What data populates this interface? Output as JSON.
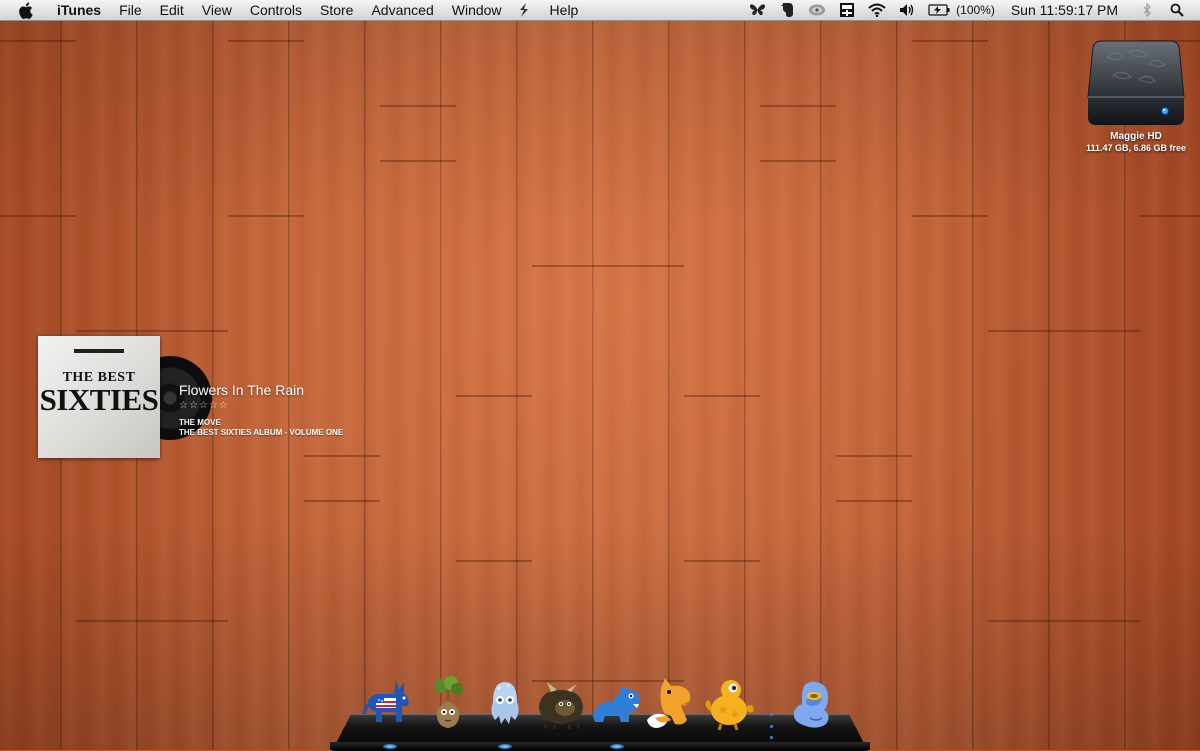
{
  "menubar": {
    "app_name": "iTunes",
    "menus": [
      "File",
      "Edit",
      "View",
      "Controls",
      "Store",
      "Advanced",
      "Window",
      "Help"
    ],
    "status_icons": [
      "butterfly-icon",
      "evernote-icon",
      "cloud-sync-icon",
      "battery-monitor-icon",
      "wifi-icon",
      "volume-icon",
      "battery-icon"
    ],
    "battery_percent": "(100%)",
    "clock": "Sun 11:59:17 PM",
    "extra_icons": [
      "bluetooth-icon",
      "spotlight-icon"
    ]
  },
  "drive": {
    "name": "Maggie HD",
    "info": "111.47 GB, 6.86 GB free",
    "accent_color": "#3aa2ff"
  },
  "now_playing": {
    "title": "Flowers In The Rain",
    "rating": "☆☆☆☆☆",
    "artist": "THE MOVE",
    "album": "THE BEST SIXTIES ALBUM - VOLUME ONE",
    "album_art": {
      "line1": "THE BEST",
      "line2": "SIXTIES"
    }
  },
  "dock": {
    "items": [
      {
        "name": "donkey-icon",
        "running": true
      },
      {
        "name": "tree-creature-icon",
        "running": false
      },
      {
        "name": "octopus-creature-icon",
        "running": true
      },
      {
        "name": "yak-creature-icon",
        "running": false
      },
      {
        "name": "blue-bear-icon",
        "running": true
      },
      {
        "name": "fox-icon",
        "running": false
      },
      {
        "name": "yellow-bird-icon",
        "running": false
      },
      {
        "name": "blue-blob-icon",
        "running": false
      }
    ],
    "indicator_color": "#2e8fd8"
  },
  "colors": {
    "wood": "#c1643a",
    "menubar": "#e3e3e3"
  }
}
